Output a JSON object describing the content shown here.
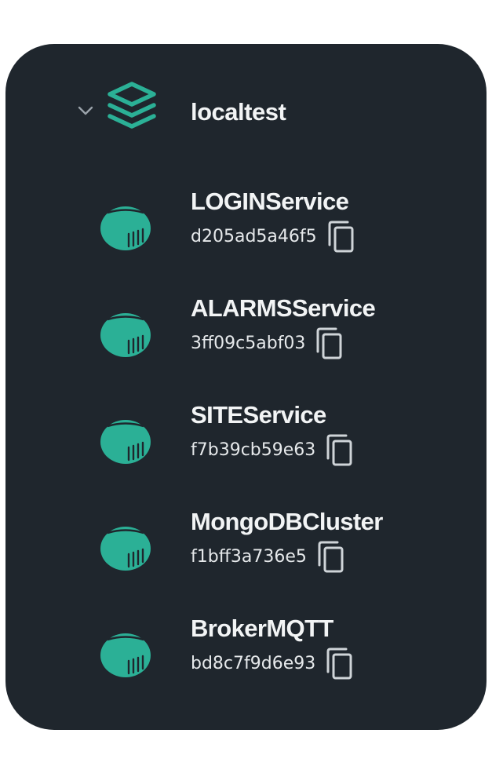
{
  "tree": {
    "root": {
      "label": "localtest",
      "expanded": true,
      "icon": "layers-stack-icon"
    },
    "services": [
      {
        "name": "LOGINService",
        "id": "d205ad5a46f5"
      },
      {
        "name": "ALARMSService",
        "id": "3ff09c5abf03"
      },
      {
        "name": "SITEService",
        "id": "f7b39cb59e63"
      },
      {
        "name": "MongoDBCluster",
        "id": "f1bff3a736e5"
      },
      {
        "name": "BrokerMQTT",
        "id": "bd8c7f9d6e93"
      }
    ]
  },
  "icons": {
    "container": "container-icon",
    "copy": "copy-icon",
    "chevron": "chevron-down-icon"
  },
  "colors": {
    "panel_background": "#1f262d",
    "accent_teal": "#2bb096",
    "text_primary": "#f2f4f5",
    "text_secondary": "#e6e9eb",
    "copy_icon": "#cfd4d8"
  }
}
